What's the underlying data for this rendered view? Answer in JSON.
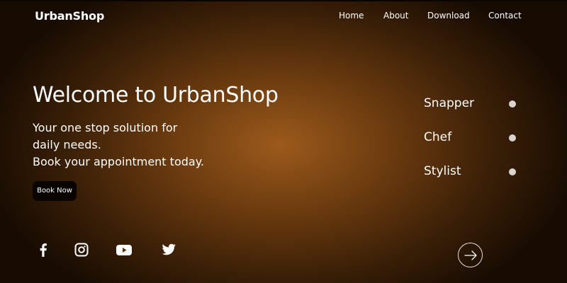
{
  "brand": {
    "name": "UrbanShop"
  },
  "nav": {
    "items": [
      "Home",
      "About",
      "Download",
      "Contact"
    ]
  },
  "hero": {
    "title": "Welcome to UrbanShop",
    "lines": [
      "Your one stop solution for",
      "daily needs.",
      "Book your appointment today."
    ],
    "cta_label": "Book Now"
  },
  "roles": [
    "Snapper",
    "Chef",
    "Stylist"
  ],
  "social": {
    "icons": [
      "facebook-icon",
      "instagram-icon",
      "youtube-icon",
      "twitter-icon"
    ]
  },
  "controls": {
    "next_icon": "arrow-right-icon"
  },
  "colors": {
    "accent": "#9c5a1c",
    "background_dark": "#180c02",
    "button_bg": "#0a0502",
    "text": "#ffffff"
  }
}
